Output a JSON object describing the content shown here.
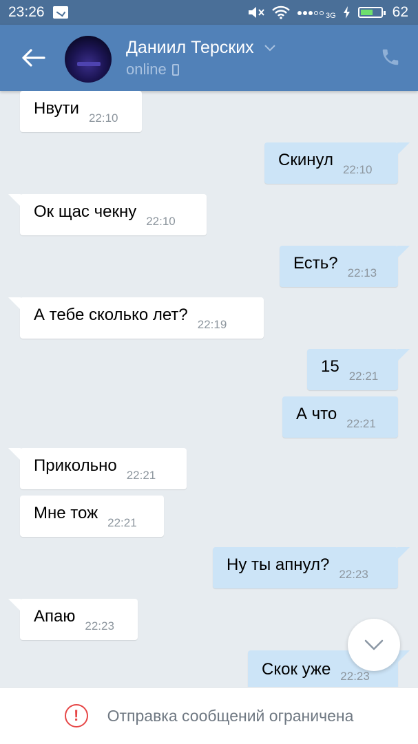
{
  "status_bar": {
    "time": "23:26",
    "network": "3G",
    "battery": "62",
    "battery_level_percent": 62
  },
  "header": {
    "contact_name": "Даниил Терских",
    "contact_status": "online"
  },
  "messages": [
    {
      "direction": "in",
      "text": "Нвути",
      "time": "22:10"
    },
    {
      "direction": "out",
      "text": "Скинул",
      "time": "22:10"
    },
    {
      "direction": "in",
      "text": "Ок щас чекну",
      "time": "22:10"
    },
    {
      "direction": "out",
      "text": "Есть?",
      "time": "22:13"
    },
    {
      "direction": "in",
      "text": "А тебе сколько лет?",
      "time": "22:19"
    },
    {
      "direction": "out",
      "text": "15",
      "time": "22:21"
    },
    {
      "direction": "out",
      "text": "А что",
      "time": "22:21"
    },
    {
      "direction": "in",
      "text": "Прикольно",
      "time": "22:21"
    },
    {
      "direction": "in",
      "text": "Мне тож",
      "time": "22:21"
    },
    {
      "direction": "out",
      "text": "Ну ты апнул?",
      "time": "22:23"
    },
    {
      "direction": "in",
      "text": "Апаю",
      "time": "22:23"
    },
    {
      "direction": "out",
      "text": "Скок уже",
      "time": "22:23"
    }
  ],
  "footer": {
    "restriction_text": "Отправка сообщений ограничена"
  },
  "colors": {
    "header": "#5181b8",
    "status_bar": "#4a6f98",
    "background": "#e7ecf0",
    "incoming_bubble": "#ffffff",
    "outgoing_bubble": "#cce4f7",
    "warning": "#e64646"
  },
  "icons": [
    "back-arrow-icon",
    "chevron-down-icon",
    "mobile-phone-icon",
    "call-icon",
    "chevron-down-icon",
    "alert-circle-icon",
    "mute-icon",
    "wifi-icon",
    "signal-icon",
    "charging-icon",
    "notification-icon"
  ]
}
